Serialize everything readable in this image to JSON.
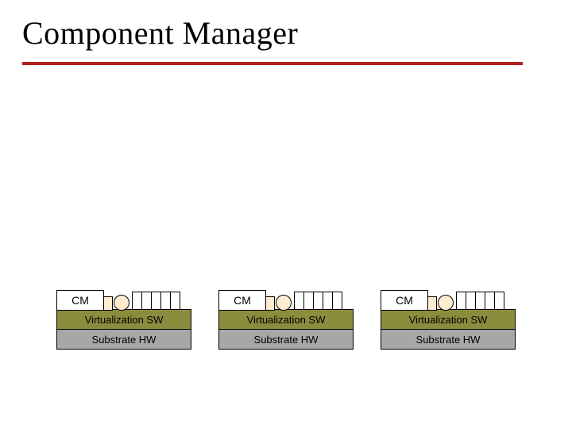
{
  "title": "Component Manager",
  "stack": {
    "cm_label": "CM",
    "virt_label": "Virtualization SW",
    "sub_label": "Substrate HW"
  },
  "colors": {
    "accent": "#b22222",
    "shape_fill": "#fdeccf",
    "virt_fill": "#8c8c3f",
    "sub_fill": "#a7a7a7"
  },
  "layout": {
    "stack_count": 3,
    "slot_count": 5,
    "shapes": [
      "square",
      "circle"
    ]
  }
}
